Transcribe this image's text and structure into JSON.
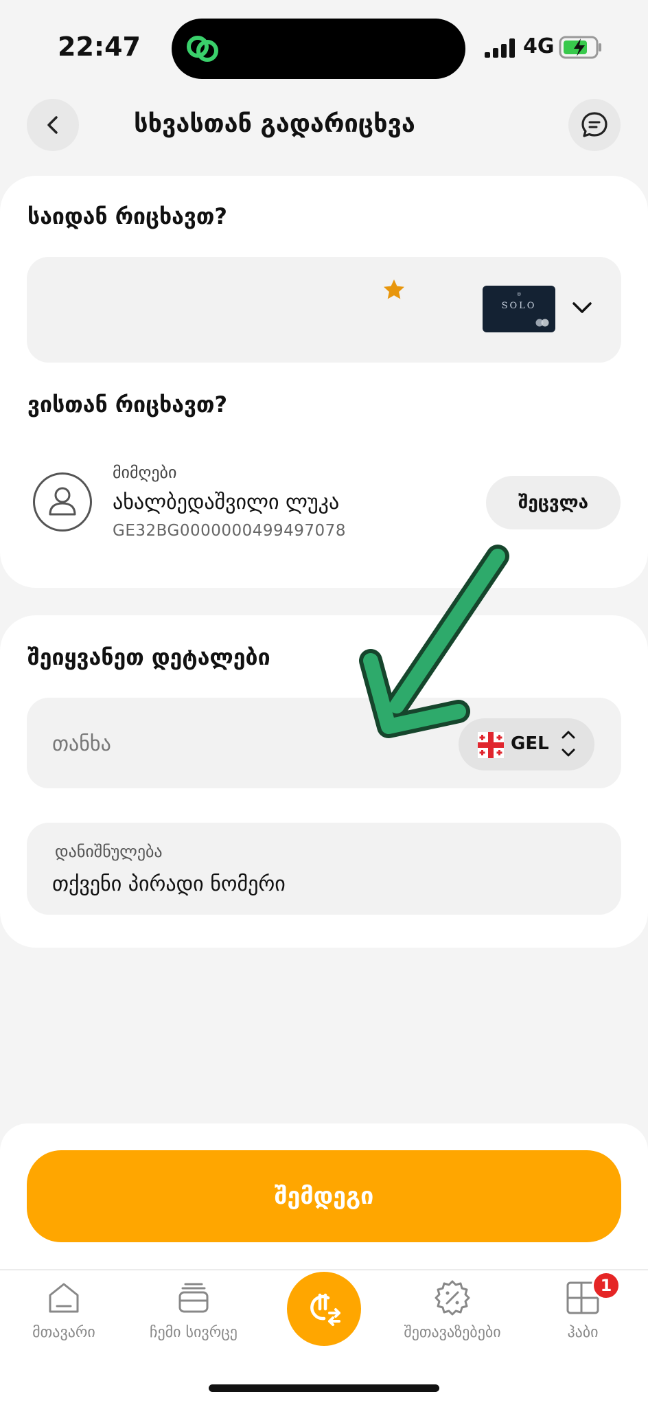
{
  "status_bar": {
    "time": "22:47",
    "network": "4G"
  },
  "header": {
    "title": "სხვასთან გადარიცხვა"
  },
  "from_section": {
    "label": "საიდან რიცხავთ?",
    "card_brand": "SOLO"
  },
  "to_section": {
    "label": "ვისთან რიცხავთ?",
    "recipient_label": "მიმღები",
    "recipient_name": "ახალბედაშვილი ლუკა",
    "recipient_iban": "GE32BG0000000499497078",
    "change_label": "შეცვლა"
  },
  "details_section": {
    "label": "შეიყვანეთ დეტალები",
    "amount_placeholder": "თანხა",
    "currency": "GEL",
    "purpose_label": "დანიშნულება",
    "purpose_value": "თქვენი პირადი ნომერი"
  },
  "next_button": "შემდეგი",
  "bottom_nav": {
    "items": [
      {
        "label": "მთავარი",
        "icon": "home-icon"
      },
      {
        "label": "ჩემი სივრცე",
        "icon": "wallet-icon"
      },
      {
        "label": "",
        "icon": "transfer-icon"
      },
      {
        "label": "შეთავაზებები",
        "icon": "discount-icon"
      },
      {
        "label": "ჰაბი",
        "icon": "hub-icon"
      }
    ],
    "hub_badge": "1"
  },
  "colors": {
    "accent": "#ffa600",
    "annotation_arrow": "#2eaa6b",
    "badge": "#e52525"
  }
}
